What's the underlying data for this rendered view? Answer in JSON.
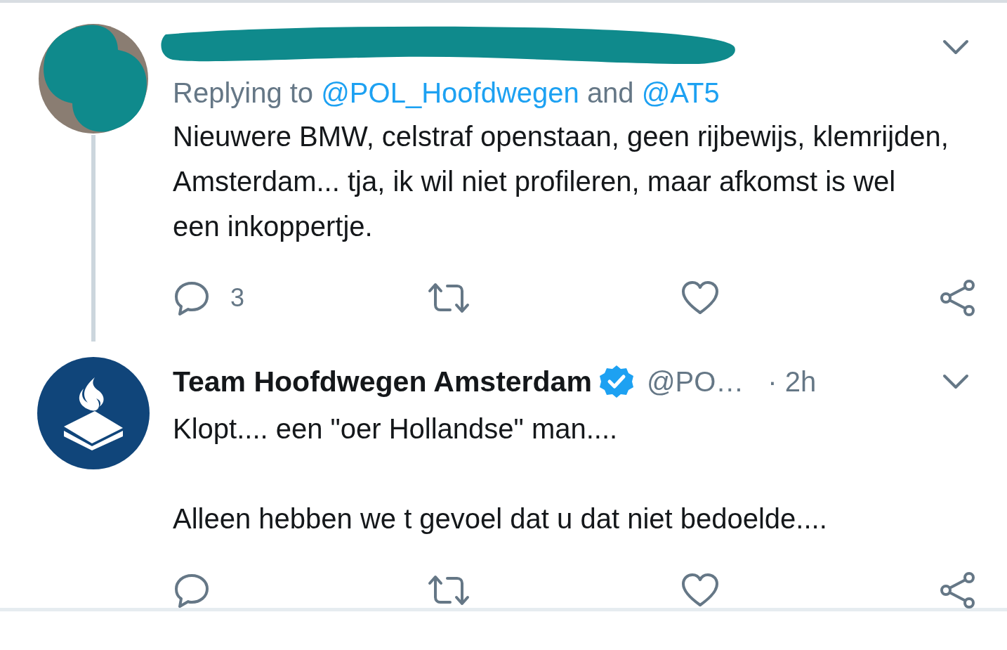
{
  "tweets": [
    {
      "redacted": true,
      "thread_line": true,
      "avatar": {
        "kind": "scribbled"
      },
      "reply_to": {
        "prefix": "Replying to",
        "mentions": [
          "@POL_Hoofdwegen",
          "@AT5"
        ],
        "joiner": "and"
      },
      "paragraphs": [
        "Nieuwere BMW, celstraf openstaan, geen rijbewijs, klemrijden, Amsterdam... tja, ik wil niet profileren, maar afkomst is wel een inkoppertje."
      ],
      "reply_count": "3"
    },
    {
      "avatar": {
        "kind": "logo"
      },
      "author": "Team Hoofdwegen Amsterdam",
      "verified": true,
      "handle": "@PO…",
      "time": "· 2h",
      "paragraphs": [
        "Klopt.... een \"oer Hollandse\" man....",
        "Alleen hebben we t gevoel dat u dat niet bedoelde...."
      ]
    }
  ]
}
